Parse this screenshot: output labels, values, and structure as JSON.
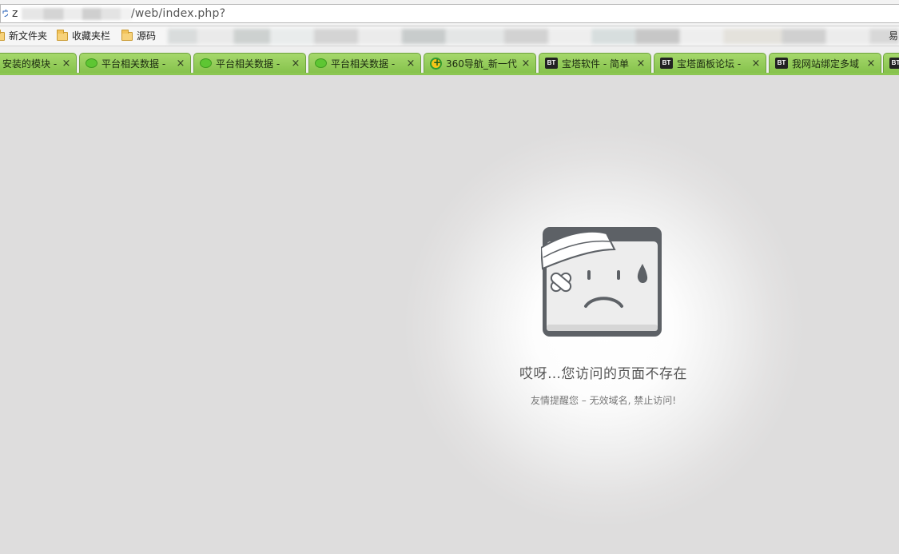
{
  "address_bar": {
    "icon_glyph": "ゥ",
    "host_visible": "z",
    "path": "/web/index.php?"
  },
  "bookmarks": [
    {
      "label": "新文件夹",
      "icon": "folder-icon"
    },
    {
      "label": "收藏夹栏",
      "icon": "folder-icon"
    },
    {
      "label": "源码",
      "icon": "folder-icon"
    }
  ],
  "bookmarks_right_fragment": "易",
  "tabs": [
    {
      "label": "安装的模块 -",
      "icon": "none"
    },
    {
      "label": "平台相关数据 -",
      "icon": "wechat-icon"
    },
    {
      "label": "平台相关数据 -",
      "icon": "wechat-icon"
    },
    {
      "label": "平台相关数据 -",
      "icon": "wechat-icon"
    },
    {
      "label": "360导航_新一代",
      "icon": "360-icon"
    },
    {
      "label": "宝塔软件 - 简单",
      "icon": "bt-icon"
    },
    {
      "label": "宝塔面板论坛 -",
      "icon": "bt-icon"
    },
    {
      "label": "我网站绑定多域",
      "icon": "bt-icon"
    },
    {
      "label": "",
      "icon": "bt-icon"
    }
  ],
  "tab_close_glyph": "×",
  "bt_favicon_text": "BT",
  "error_page": {
    "title": "哎呀…您访问的页面不存在",
    "subtitle": "友情提醒您 – 无效域名, 禁止访问!"
  },
  "colors": {
    "tab_green": "#8cc652",
    "page_bg": "#dedddd",
    "icon_dark": "#5d6166"
  }
}
